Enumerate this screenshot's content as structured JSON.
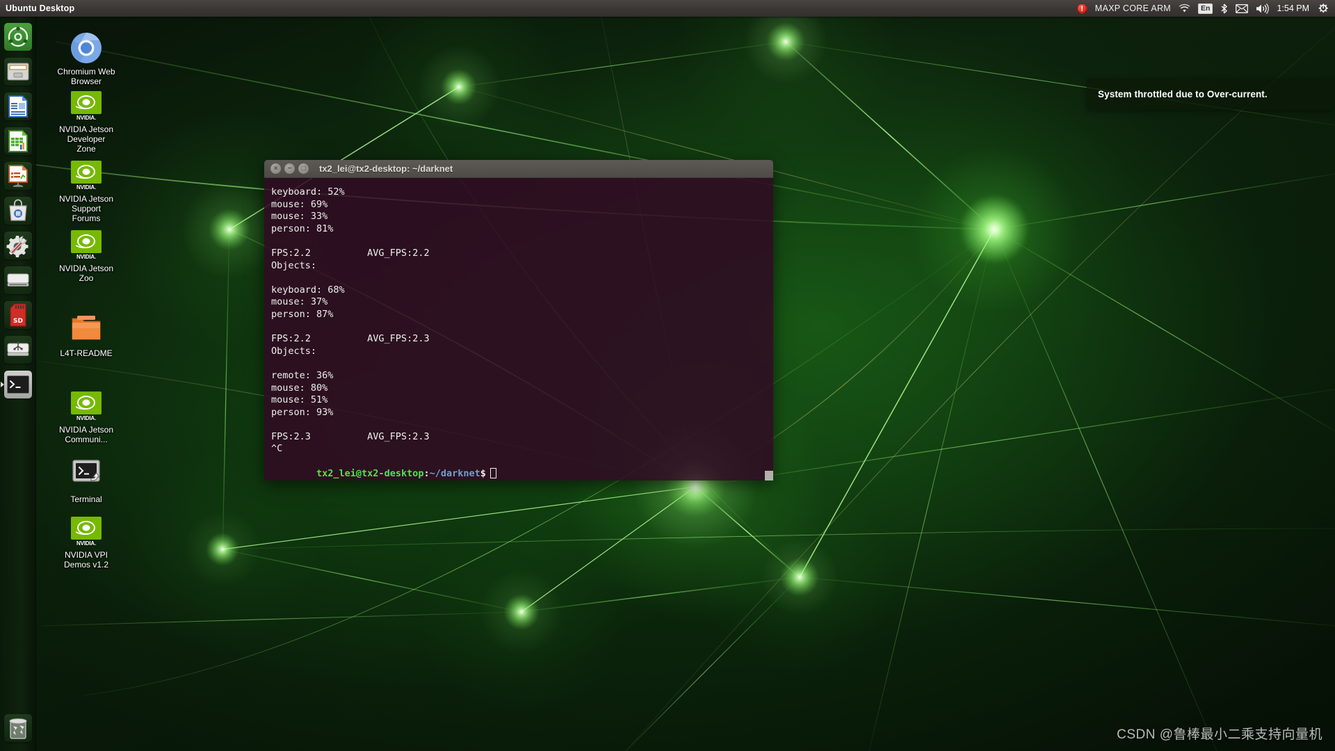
{
  "panel": {
    "title": "Ubuntu Desktop",
    "indicators": {
      "warning_glyph": "!",
      "power_mode": "MAXP CORE ARM",
      "wifi_icon": "wifi-icon",
      "keyboard_layout": "En",
      "bluetooth_icon": "bluetooth-icon",
      "mail_icon": "mail-icon",
      "volume_icon": "volume-icon",
      "clock": "1:54 PM",
      "session_icon": "power-gear-icon"
    }
  },
  "launcher": {
    "items": [
      {
        "name": "ubuntu-dash",
        "icon": "ubuntu-logo-icon"
      },
      {
        "name": "files",
        "icon": "file-cabinet-icon"
      },
      {
        "name": "libreoffice-writer",
        "icon": "document-icon"
      },
      {
        "name": "libreoffice-calc",
        "icon": "spreadsheet-icon"
      },
      {
        "name": "libreoffice-impress",
        "icon": "presentation-icon"
      },
      {
        "name": "software-center",
        "icon": "shopping-bag-icon"
      },
      {
        "name": "system-settings",
        "icon": "gear-wrench-icon"
      },
      {
        "name": "disk-drive",
        "icon": "hard-drive-icon"
      },
      {
        "name": "sd-card",
        "icon": "sd-card-icon"
      },
      {
        "name": "usb-drive",
        "icon": "usb-drive-icon"
      },
      {
        "name": "terminal",
        "icon": "terminal-icon",
        "running": true
      }
    ],
    "trash": {
      "name": "trash",
      "icon": "trash-bin-icon"
    }
  },
  "desktop_icons": [
    {
      "label": "Chromium Web Browser",
      "icon": "chromium-icon"
    },
    {
      "label": "NVIDIA Jetson Developer Zone",
      "icon": "nvidia-icon"
    },
    {
      "label": "NVIDIA Jetson Support Forums",
      "icon": "nvidia-icon"
    },
    {
      "label": "NVIDIA Jetson Zoo",
      "icon": "nvidia-icon"
    },
    {
      "label": "L4T-README",
      "icon": "folder-icon"
    },
    {
      "label": "NVIDIA Jetson Communi...",
      "icon": "nvidia-icon"
    },
    {
      "label": "Terminal",
      "icon": "terminal-shortcut-icon"
    },
    {
      "label": "NVIDIA VPI Demos v1.2",
      "icon": "nvidia-icon"
    }
  ],
  "terminal": {
    "title": "tx2_lei@tx2-desktop: ~/darknet",
    "buttons": {
      "close": "×",
      "minimize": "−",
      "maximize": "□"
    },
    "lines": [
      "keyboard: 52%",
      "mouse: 69%",
      "mouse: 33%",
      "person: 81%",
      "",
      "FPS:2.2\t\tAVG_FPS:2.2",
      "Objects:",
      "",
      "keyboard: 68%",
      "mouse: 37%",
      "person: 87%",
      "",
      "FPS:2.2\t\tAVG_FPS:2.3",
      "Objects:",
      "",
      "remote: 36%",
      "mouse: 80%",
      "mouse: 51%",
      "person: 93%",
      "",
      "FPS:2.3\t\tAVG_FPS:2.3",
      "^C"
    ],
    "prompt": {
      "user_host": "tx2_lei@tx2-desktop",
      "separator": ":",
      "path": "~/darknet",
      "symbol": "$"
    }
  },
  "notification": {
    "message": "System throttled due to Over-current."
  },
  "watermark": {
    "text": "CSDN @鲁棒最小二乘支持向量机"
  },
  "colors": {
    "terminal_bg": "#300A24",
    "nvidia_green": "#76b900",
    "prompt_user": "#4EE44E",
    "prompt_path": "#729FCF",
    "panel_bg": "#3C3835",
    "warning_red": "#D21B10"
  }
}
